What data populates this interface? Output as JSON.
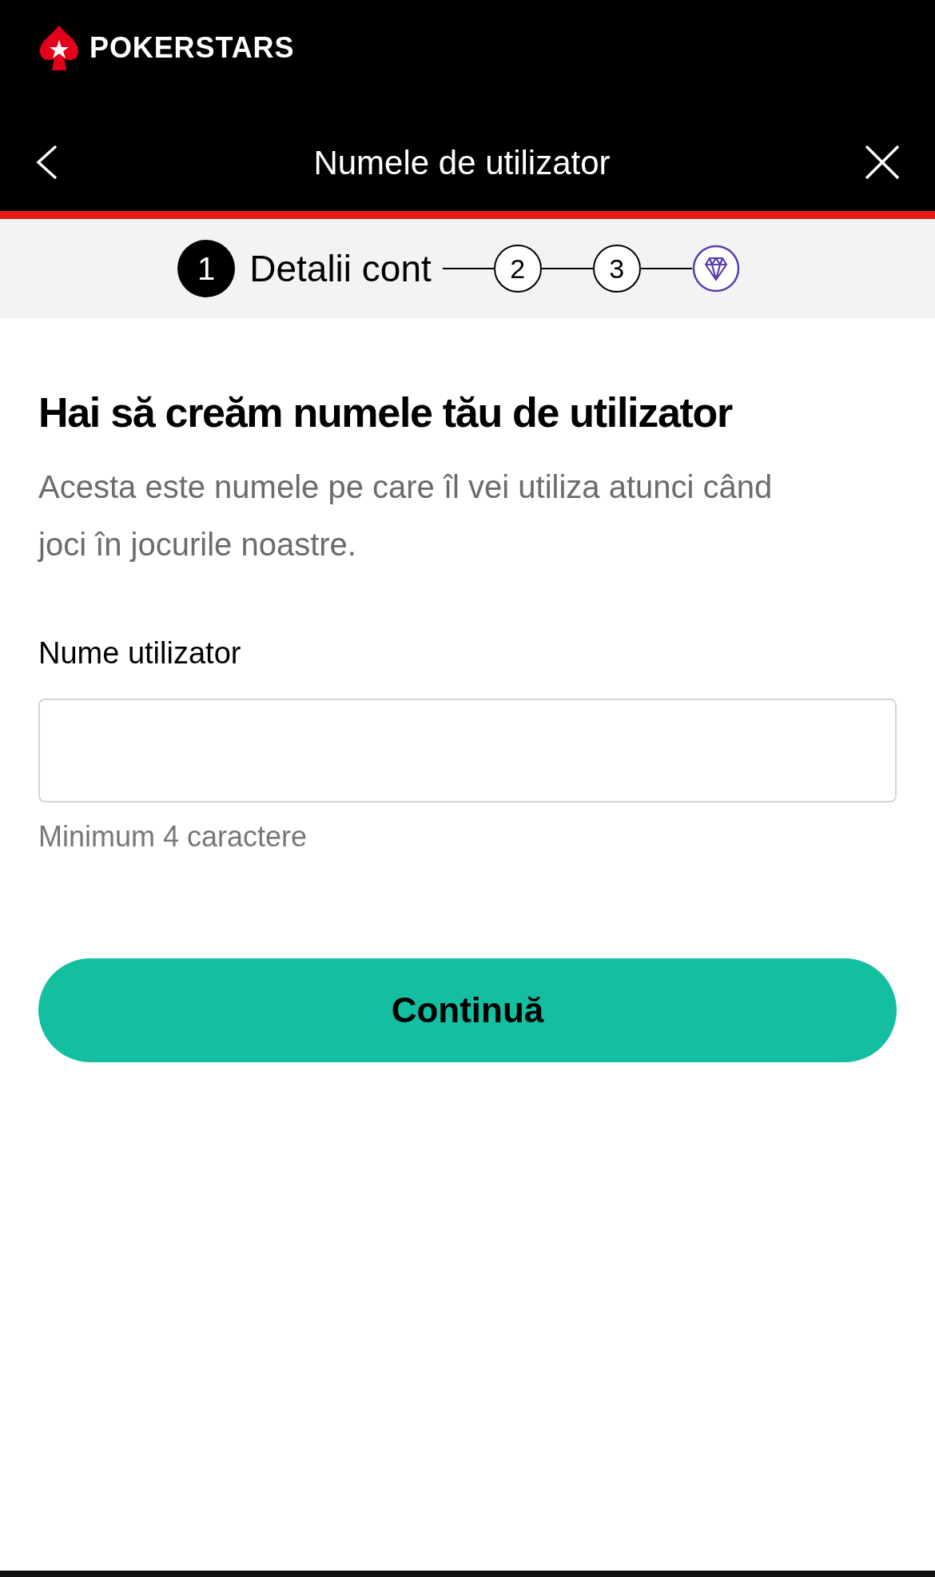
{
  "brand": {
    "name": "POKERSTARS"
  },
  "title_bar": {
    "title": "Numele de utilizator"
  },
  "steps": [
    {
      "kind": "number",
      "number": "1",
      "label": "Detalii cont",
      "selected": true
    },
    {
      "kind": "number",
      "number": "2",
      "selected": false
    },
    {
      "kind": "number",
      "number": "3",
      "selected": false
    },
    {
      "kind": "diamond",
      "selected": false
    }
  ],
  "heading": "Hai să creăm numele tău de utilizator",
  "description": "Acesta este numele pe care îl vei utiliza atunci când joci în jocurile noastre.",
  "field": {
    "label": "Nume utilizator",
    "hint": "Minimum 4 caractere"
  },
  "button": "Continuă"
}
